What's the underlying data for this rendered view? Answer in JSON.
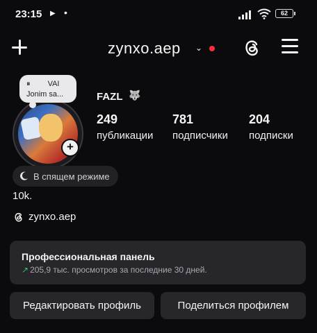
{
  "status_bar": {
    "time": "23:15",
    "play_glyph": "▶",
    "dot_glyph": "•",
    "battery": "62",
    "signal_icon": "signal-icon",
    "wifi_icon": "wifi-icon"
  },
  "header": {
    "username": "zynxo.aep",
    "chevron": "⌄",
    "notification_dot_color": "#ff2d3a",
    "left_icon": "plus-icon",
    "right_icons": [
      "threads-icon",
      "menu-icon"
    ]
  },
  "note": {
    "line1_icon": "⏸",
    "line1_text": "VAI",
    "line2_text": "Jonim sa..."
  },
  "profile": {
    "display_name": "FAZL",
    "name_emoji": "🐺",
    "stats": [
      {
        "value": "249",
        "label": "публикации"
      },
      {
        "value": "781",
        "label": "подписчики"
      },
      {
        "value": "204",
        "label": "подписки"
      }
    ],
    "sleep_status": "В спящем режиме",
    "bio": "10k.",
    "threads_handle": "zynxo.aep"
  },
  "pro_panel": {
    "title": "Профессиональная панель",
    "subtitle": "205,9 тыс. просмотров за последние 30 дней.",
    "accent_color": "#3fbf6a"
  },
  "buttons": {
    "edit_profile": "Редактировать профиль",
    "share_profile": "Поделиться профилем"
  }
}
